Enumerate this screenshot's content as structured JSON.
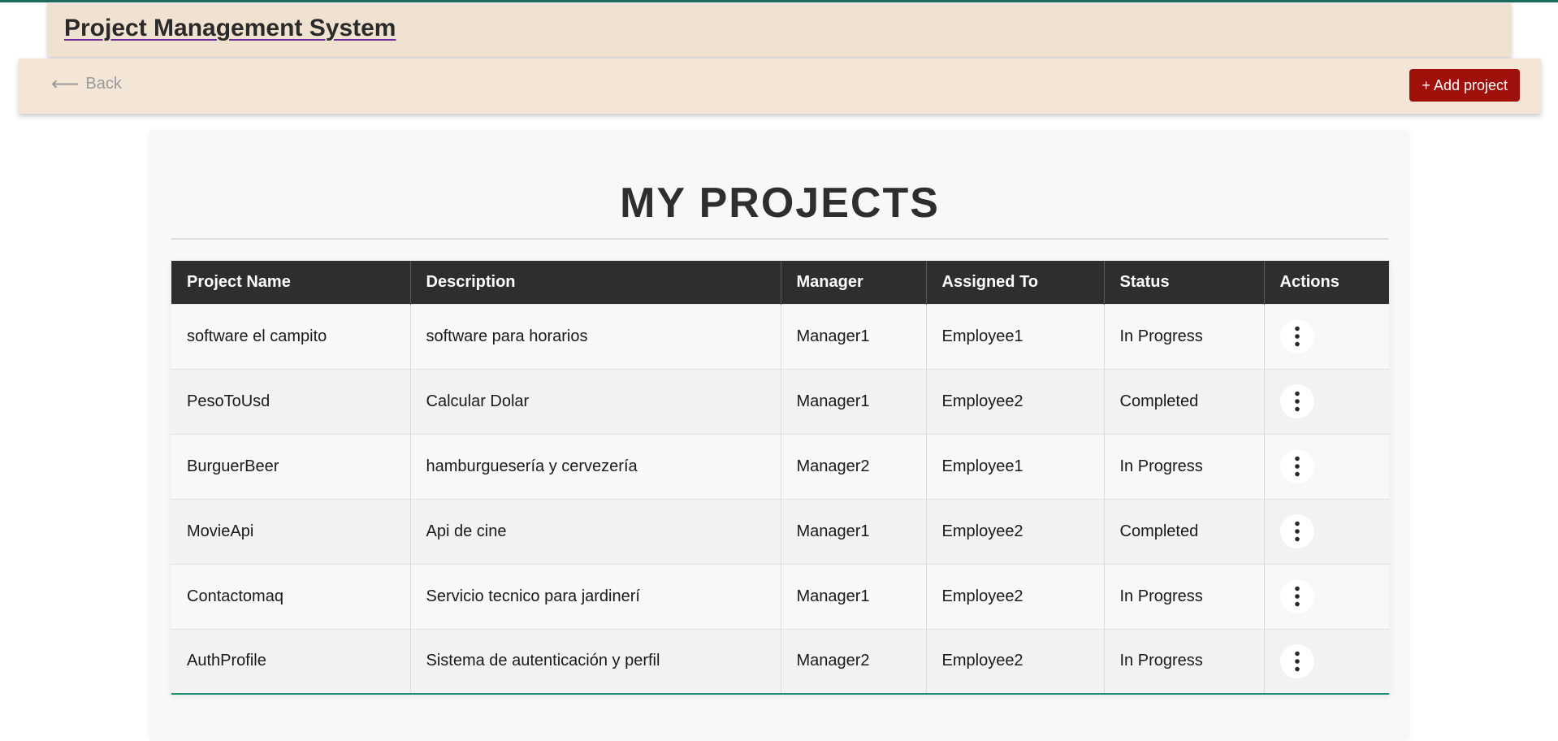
{
  "header": {
    "title": "Project Management System"
  },
  "nav": {
    "back_arrow": "⟵",
    "back_label": "Back",
    "add_project_label": "+ Add project"
  },
  "main": {
    "title": "MY PROJECTS",
    "columns": [
      "Project Name",
      "Description",
      "Manager",
      "Assigned To",
      "Status",
      "Actions"
    ],
    "rows": [
      {
        "name": "software el campito",
        "description": "software para horarios",
        "manager": "Manager1",
        "assigned_to": "Employee1",
        "status": "In Progress"
      },
      {
        "name": "PesoToUsd",
        "description": "Calcular Dolar",
        "manager": "Manager1",
        "assigned_to": "Employee2",
        "status": "Completed"
      },
      {
        "name": "BurguerBeer",
        "description": "hamburguesería y cervezería",
        "manager": "Manager2",
        "assigned_to": "Employee1",
        "status": "In Progress"
      },
      {
        "name": "MovieApi",
        "description": "Api de cine",
        "manager": "Manager1",
        "assigned_to": "Employee2",
        "status": "Completed"
      },
      {
        "name": "Contactomaq",
        "description": "Servicio tecnico para jardinerí",
        "manager": "Manager1",
        "assigned_to": "Employee2",
        "status": "In Progress"
      },
      {
        "name": "AuthProfile",
        "description": "Sistema de autenticación y perfil",
        "manager": "Manager2",
        "assigned_to": "Employee2",
        "status": "In Progress"
      }
    ],
    "row_action_icon": "vertical-dots-icon"
  },
  "colors": {
    "top_accent": "#1e6b5e",
    "title_bar_bg": "#f0e2d0",
    "nav_bar_bg": "#f4e6d7",
    "add_button_bg": "#a0100a",
    "table_header_bg": "#2e2e2e",
    "table_bottom_border": "#1e9078"
  }
}
